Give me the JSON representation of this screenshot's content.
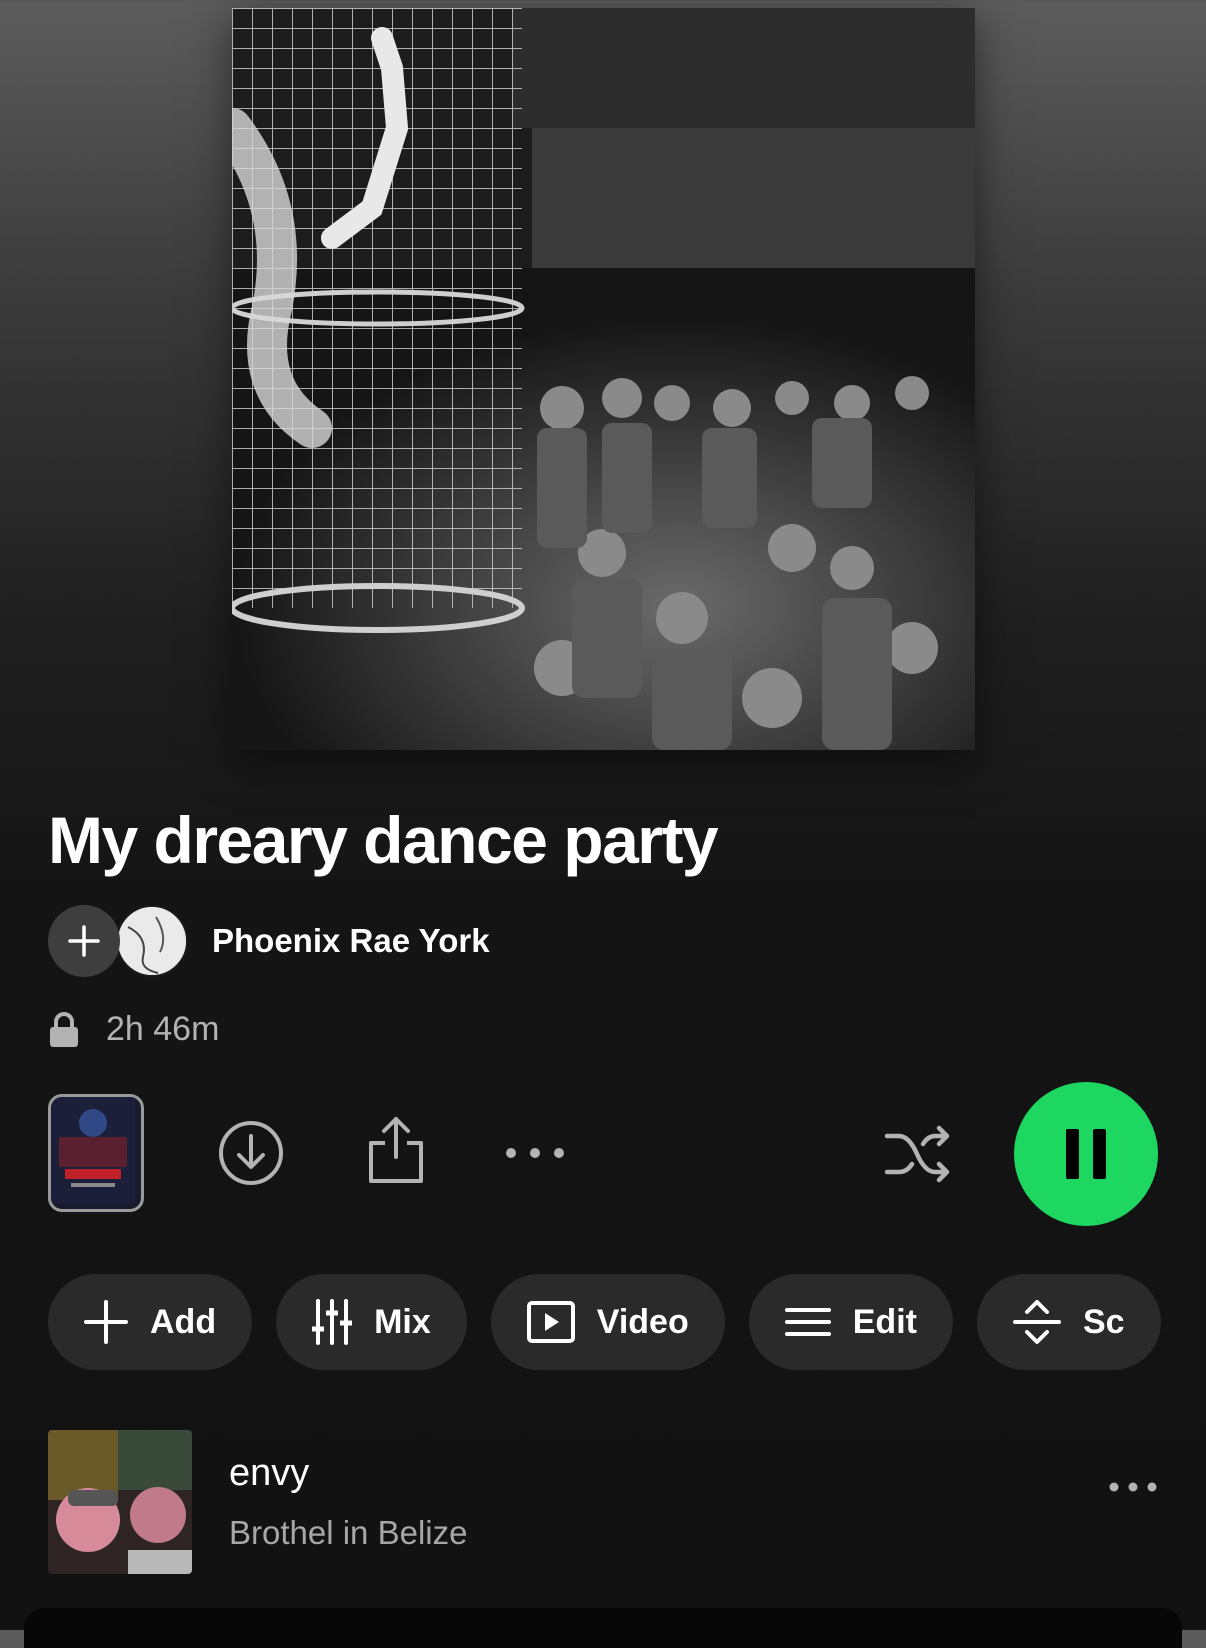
{
  "playlist": {
    "title": "My dreary dance party",
    "owner": "Phoenix Rae York",
    "duration": "2h 46m",
    "visibility": "private"
  },
  "controls": {
    "icons": [
      "download-icon",
      "share-icon",
      "more-icon",
      "shuffle-icon",
      "pause-icon"
    ],
    "play_state": "playing"
  },
  "chips": [
    {
      "label": "Add",
      "icon": "plus-icon"
    },
    {
      "label": "Mix",
      "icon": "sliders-icon"
    },
    {
      "label": "Video",
      "icon": "video-icon"
    },
    {
      "label": "Edit",
      "icon": "edit-lines-icon"
    },
    {
      "label": "Sc",
      "icon": "sort-icon"
    }
  ],
  "tracks": [
    {
      "title": "envy",
      "artist": "Brothel in Belize"
    }
  ],
  "colors": {
    "accent": "#1ed760",
    "background": "#121212",
    "chip": "#2a2a2a",
    "secondary_text": "#a7a7a7"
  }
}
